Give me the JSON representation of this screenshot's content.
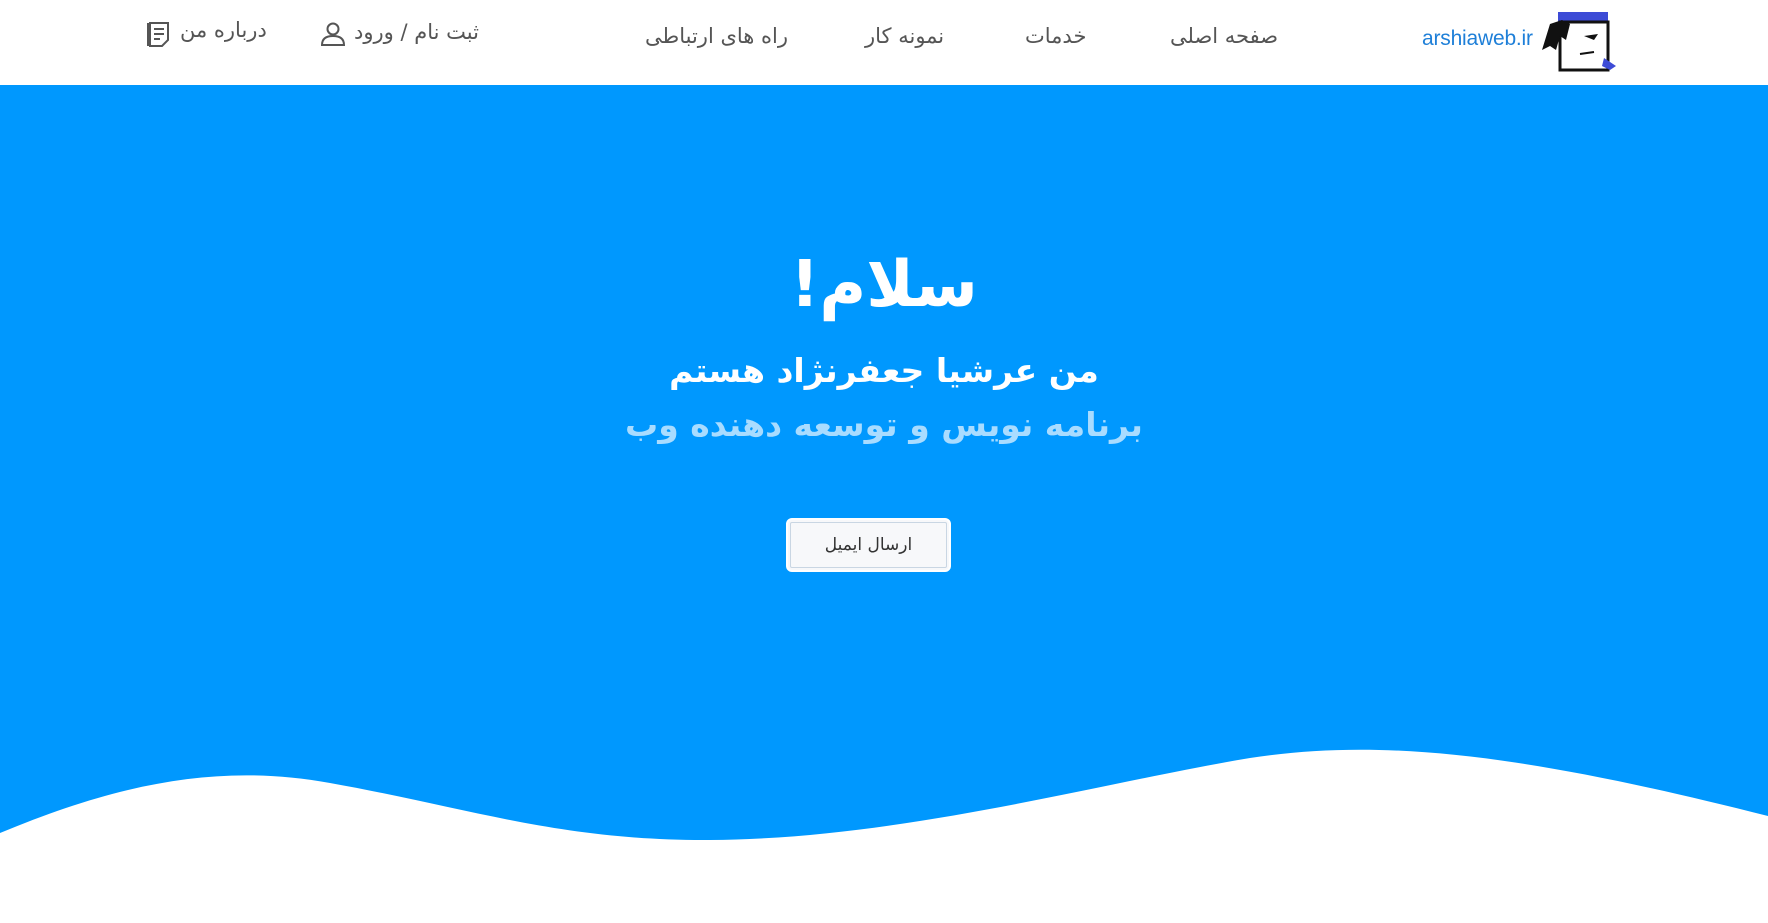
{
  "header": {
    "logo_text": "arshiaweb.ir",
    "nav": {
      "home": "صفحه اصلی",
      "services": "خدمات",
      "portfolio": "نمونه کار",
      "contact": "راه های ارتباطی"
    },
    "auth_label": "ثبت نام / ورود",
    "about_label": "درباره من"
  },
  "hero": {
    "title": "سلام!",
    "subtitle": "من عرشیا جعفرنژاد هستم",
    "role": "برنامه نویس و توسعه دهنده وب",
    "email_button": "ارسال ایمیل"
  },
  "colors": {
    "hero_bg": "#0098fe",
    "logo_text": "#1e7fd8",
    "role_text": "#a9dcff",
    "nav_text": "#555555"
  },
  "icons": {
    "user": "user-icon",
    "about": "document-icon",
    "logo": "logo-avatar-icon"
  }
}
